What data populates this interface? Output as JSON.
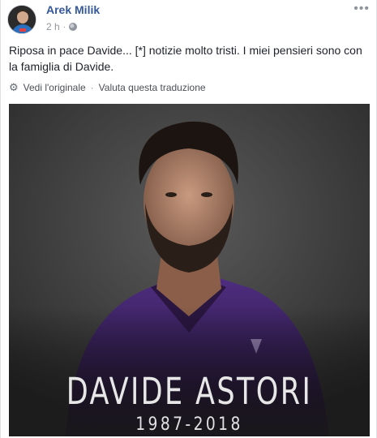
{
  "post": {
    "author": "Arek Milik",
    "time": "2 h",
    "separator": "·",
    "more": "•••",
    "text": "Riposa in pace Davide... [*] notizie molto tristi. I miei pensieri sono con la famiglia di Davide.",
    "translate": {
      "see_original": "Vedi l'originale",
      "rate_translation": "Valuta questa traduzione",
      "separator": "·"
    },
    "photo": {
      "name": "DAVIDE ASTORI",
      "years": "1987-2018"
    }
  },
  "icons": {
    "privacy": "globe-icon",
    "settings": "gear-icon",
    "options": "more-options-icon"
  },
  "colors": {
    "author_link": "#365899",
    "meta_text": "#90949c",
    "body_text": "#1d2129",
    "jersey": "#4a2a76",
    "photo_bg": "#3f3f3f"
  }
}
